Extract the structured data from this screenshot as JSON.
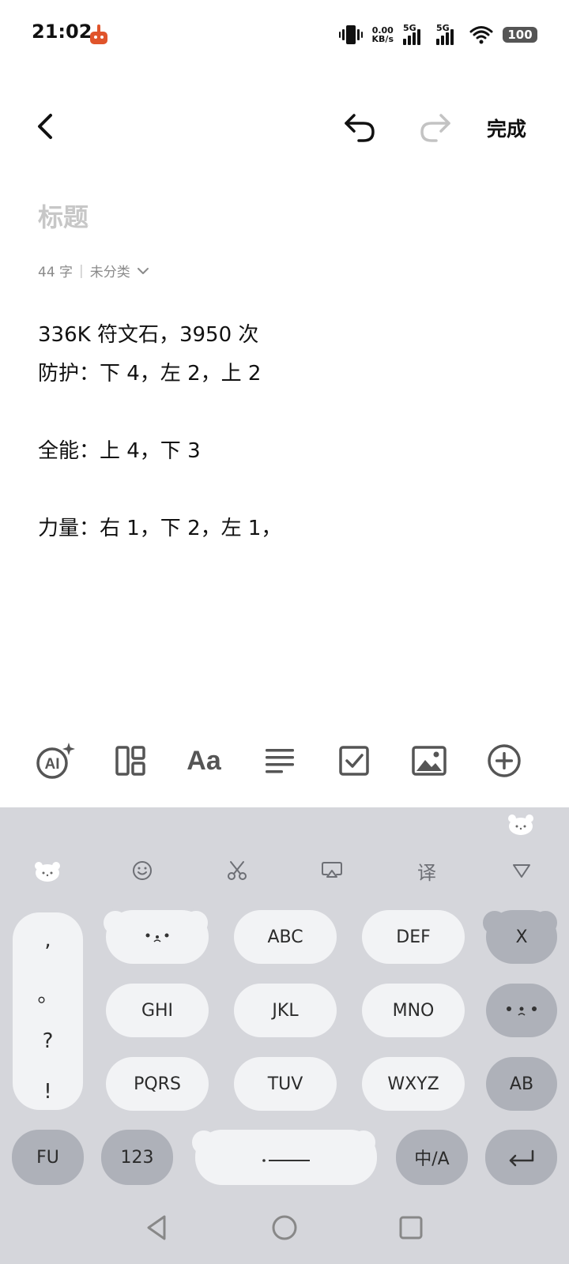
{
  "status_bar": {
    "time": "21:02",
    "net_speed_value": "0.00",
    "net_speed_unit": "KB/s",
    "signal1_label": "5G",
    "signal2_label": "5G",
    "battery": "100"
  },
  "header": {
    "done_label": "完成"
  },
  "note": {
    "title_placeholder": "标题",
    "meta_count": "44 字",
    "meta_separator": "|",
    "meta_category": "未分类",
    "lines": [
      "336K 符文石，3950 次",
      "防护：下 4，左 2，上 2",
      "",
      "全能：上 4，下 3",
      "",
      "力量：右 1，下 2，左 1，"
    ]
  },
  "format_toolbar": {
    "icons": [
      "ai-icon",
      "layout-icon",
      "text-style-icon",
      "align-icon",
      "checklist-icon",
      "image-icon",
      "add-icon"
    ],
    "text_style_label": "Aa",
    "ai_label": "AI"
  },
  "keyboard": {
    "toolbar": {
      "translate_label": "译"
    },
    "punctuation": [
      ",",
      "。",
      "?",
      "!"
    ],
    "keys": {
      "abc": "ABC",
      "def": "DEF",
      "delete": "X",
      "ghi": "GHI",
      "jkl": "JKL",
      "mno": "MNO",
      "pqrs": "PQRS",
      "tuv": "TUV",
      "wxyz": "WXYZ",
      "ab": "AB",
      "fu": "FU",
      "num": "123",
      "lang": "中/A"
    },
    "colors": {
      "background": "#d5d6db",
      "light_key": "#f2f3f5",
      "dark_key": "#aeb1b9"
    }
  }
}
